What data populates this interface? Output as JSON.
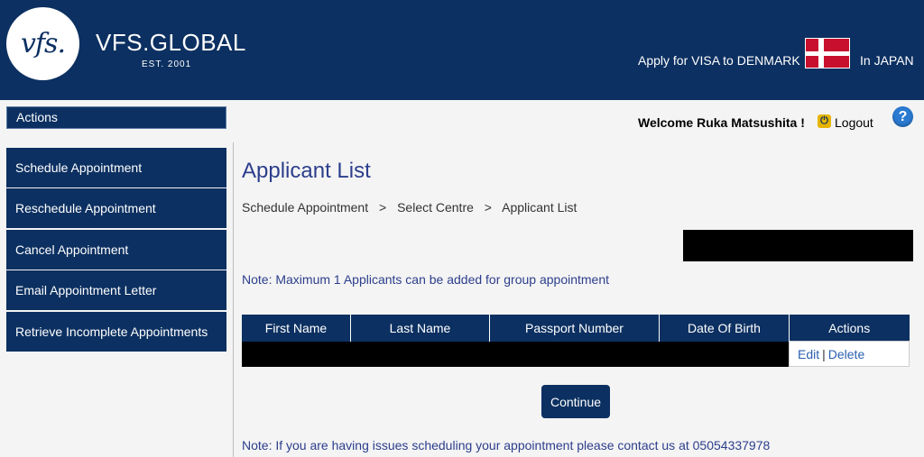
{
  "header": {
    "logo_mark": "vfs.",
    "brand": "VFS.GLOBAL",
    "established": "EST. 2001",
    "apply_text": "Apply for VISA to DENMARK",
    "country_text": "In JAPAN"
  },
  "sidebar": {
    "title": "Actions",
    "items": [
      {
        "label": "Schedule Appointment"
      },
      {
        "label": "Reschedule Appointment"
      },
      {
        "label": "Cancel Appointment"
      },
      {
        "label": "Email Appointment Letter"
      },
      {
        "label": "Retrieve Incomplete Appointments"
      }
    ]
  },
  "userbar": {
    "welcome": "Welcome Ruka Matsushita !",
    "logout": "Logout",
    "help": "?"
  },
  "main": {
    "title": "Applicant List",
    "breadcrumb": [
      "Schedule Appointment",
      "Select Centre",
      "Applicant List"
    ],
    "breadcrumb_sep": ">",
    "note_max": "Note: Maximum 1 Applicants can be added for group appointment",
    "table": {
      "headers": [
        "First Name",
        "Last Name",
        "Passport Number",
        "Date Of Birth",
        "Actions"
      ],
      "row_actions": {
        "edit": "Edit",
        "divider": "|",
        "delete": "Delete"
      }
    },
    "continue": "Continue",
    "note_bottom": "Note: If you are having issues scheduling your appointment please contact us at 05054337978"
  },
  "colors": {
    "navy": "#0c3061",
    "title_blue": "#2c3e8c",
    "link_blue": "#2a5fb0",
    "flag_red": "#c8102e"
  },
  "icons": [
    "logout-icon",
    "help-icon",
    "denmark-flag-icon"
  ]
}
